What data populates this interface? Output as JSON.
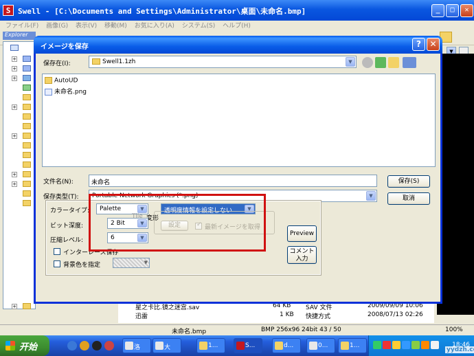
{
  "app": {
    "title": "Swell - [C:\\Documents and Settings\\Administrator\\桌面\\未命名.bmp]",
    "icon_letter": "S",
    "menu": [
      "ファイル(F)",
      "画像(G)",
      "表示(V)",
      "移動(M)",
      "お気に入り(A)",
      "システム(S)",
      "ヘルプ(H)"
    ],
    "explorer_label": "Explorer"
  },
  "dialog": {
    "title": "イメージを保存",
    "help_label": "?",
    "close_label": "✕",
    "save_in_label": "保存在(I):",
    "save_in_value": "Swell1.1zh",
    "files": [
      {
        "name": "AutoUD",
        "icon": "folder-icon"
      },
      {
        "name": "未命名.png",
        "icon": "png-file-icon"
      }
    ],
    "filename_label": "文件名(N):",
    "filename_value": "未命名",
    "filetype_label": "保存类型(T):",
    "filetype_value": "Portable Network Graphics (*.png)",
    "save_button": "保存(S)",
    "cancel_button": "取消",
    "options": {
      "color_type_label": "カラータイプ:",
      "color_type_value": "Palette",
      "transparency_value": "透明度情報を設定しない",
      "bit_depth_label": "ビット深度:",
      "bit_depth_value": "2 Bit",
      "compression_label": "圧縮レベル:",
      "compression_value": "6",
      "interlace_label": "インターレース保存",
      "bgcolor_label": "背景色を指定",
      "transform_label": "変形",
      "set_button": "設定",
      "latest_image_label": "最新イメージを取得",
      "preview_button": "Preview",
      "comment_button_line1": "コメント",
      "comment_button_line2": "入力",
      "truncated_label": "Tile"
    }
  },
  "background_files": [
    {
      "name": "星之卡比.镜之迷宫.sav",
      "size": "64 KB",
      "type": "SAV 文件",
      "date": "2009/09/09 10:06"
    },
    {
      "name": "迅雷",
      "size": "1 KB",
      "type": "快捷方式",
      "date": "2008/07/13 02:26"
    }
  ],
  "status": {
    "filename": "未命名.bmp",
    "info": "BMP 256x96 24bit 43 / 50",
    "zoom": "100%"
  },
  "taskbar": {
    "start_label": "开始",
    "tasks": [
      "洛",
      "大",
      "1...",
      "S...",
      "d...",
      "0...",
      "1..."
    ],
    "clock": "18:46"
  },
  "watermark": "yydzh.com",
  "colors": {
    "title_blue": "#0a57e0",
    "close_red": "#c7401b",
    "highlight_red": "#d01010",
    "start_green": "#3c8d2f"
  }
}
